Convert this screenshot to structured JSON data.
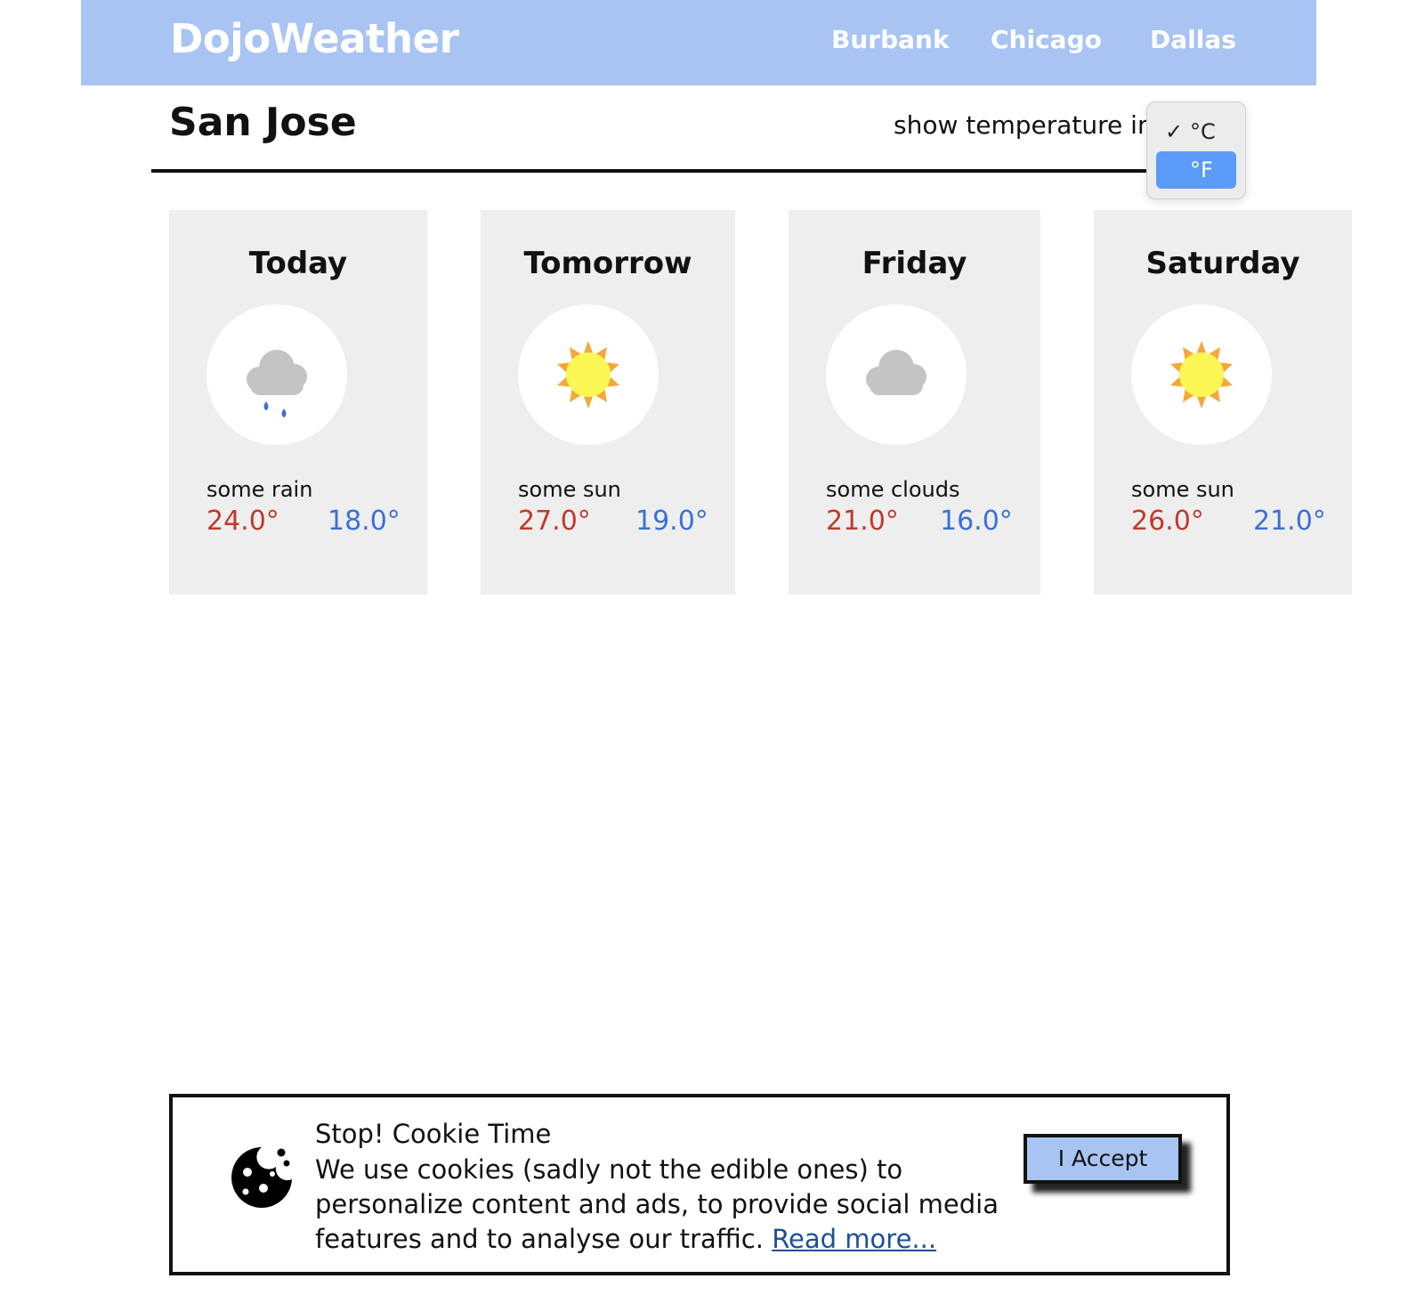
{
  "header": {
    "brand": "DojoWeather",
    "nav": [
      "Burbank",
      "Chicago",
      "Dallas"
    ]
  },
  "city": "San Jose",
  "temperature_control": {
    "label": "show temperature in",
    "options": [
      "°C",
      "°F"
    ],
    "selected": "°C",
    "highlighted": "°F"
  },
  "forecast": [
    {
      "day": "Today",
      "icon": "rain-cloud-icon",
      "desc": "some rain",
      "high": "24.0°",
      "low": "18.0°"
    },
    {
      "day": "Tomorrow",
      "icon": "sun-icon",
      "desc": "some sun",
      "high": "27.0°",
      "low": "19.0°"
    },
    {
      "day": "Friday",
      "icon": "cloud-icon",
      "desc": "some clouds",
      "high": "21.0°",
      "low": "16.0°"
    },
    {
      "day": "Saturday",
      "icon": "sun-icon",
      "desc": "some sun",
      "high": "26.0°",
      "low": "21.0°"
    }
  ],
  "cookie_banner": {
    "title": "Stop! Cookie Time",
    "text": "We use cookies (sadly not the edible ones) to personalize content and ads, to provide social media features and to analyse our traffic.",
    "link": "Read more...",
    "button": "I Accept"
  },
  "colors": {
    "header_bg": "#a8c4f3",
    "high_temp": "#c0392b",
    "low_temp": "#3b6fd8",
    "card_bg": "#eeeeee",
    "dropdown_highlight": "#5b9bf8"
  }
}
